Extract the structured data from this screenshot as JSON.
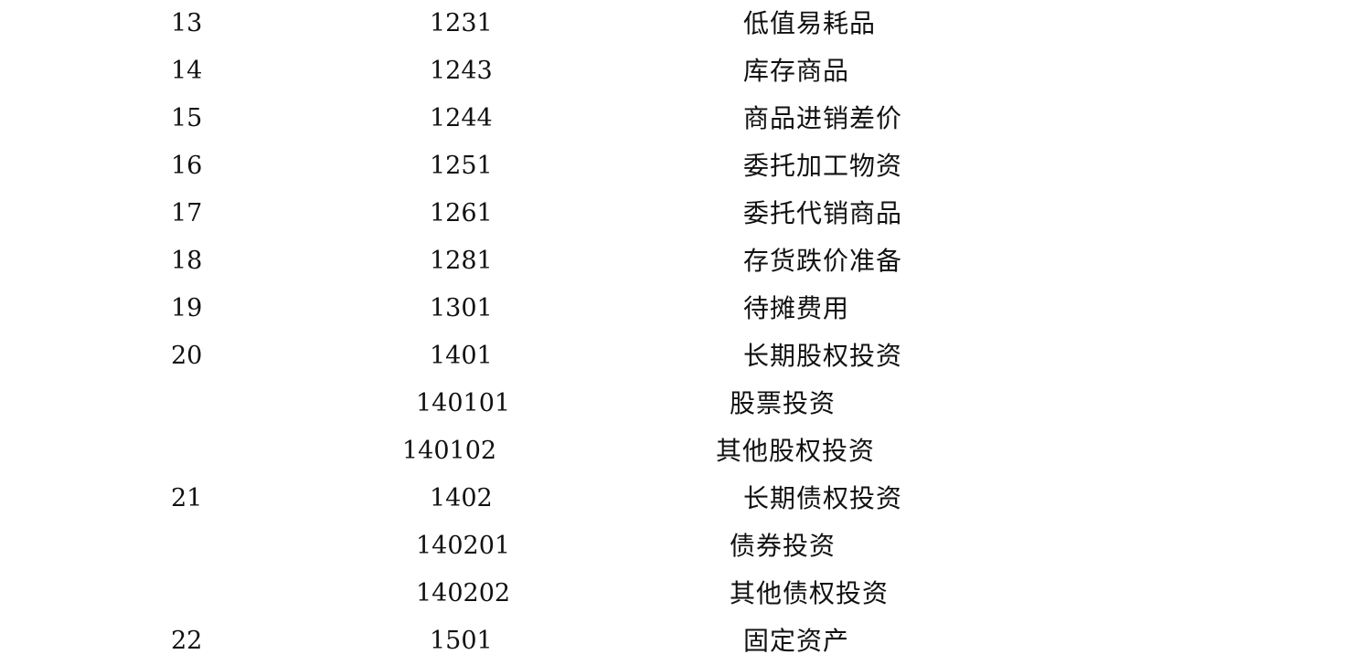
{
  "rows": [
    {
      "seq": "13",
      "code": "1231",
      "name": "低值易耗品",
      "level": 1
    },
    {
      "seq": "14",
      "code": "1243",
      "name": "库存商品",
      "level": 1
    },
    {
      "seq": "15",
      "code": "1244",
      "name": "商品进销差价",
      "level": 1
    },
    {
      "seq": "16",
      "code": "1251",
      "name": "委托加工物资",
      "level": 1
    },
    {
      "seq": "17",
      "code": "1261",
      "name": "委托代销商品",
      "level": 1
    },
    {
      "seq": "18",
      "code": "1281",
      "name": "存货跌价准备",
      "level": 1
    },
    {
      "seq": "19",
      "code": "1301",
      "name": "待摊费用",
      "level": 1
    },
    {
      "seq": "20",
      "code": "1401",
      "name": "长期股权投资",
      "level": 1
    },
    {
      "seq": "",
      "code": "140101",
      "name": "股票投资",
      "level": 2
    },
    {
      "seq": "",
      "code": "140102",
      "name": "其他股权投资",
      "level": 2
    },
    {
      "seq": "21",
      "code": "1402",
      "name": "长期债权投资",
      "level": 1
    },
    {
      "seq": "",
      "code": "140201",
      "name": "债券投资",
      "level": 2
    },
    {
      "seq": "",
      "code": "140202",
      "name": "其他债权投资",
      "level": 2
    },
    {
      "seq": "22",
      "code": "1501",
      "name": "固定资产",
      "level": 1
    }
  ]
}
